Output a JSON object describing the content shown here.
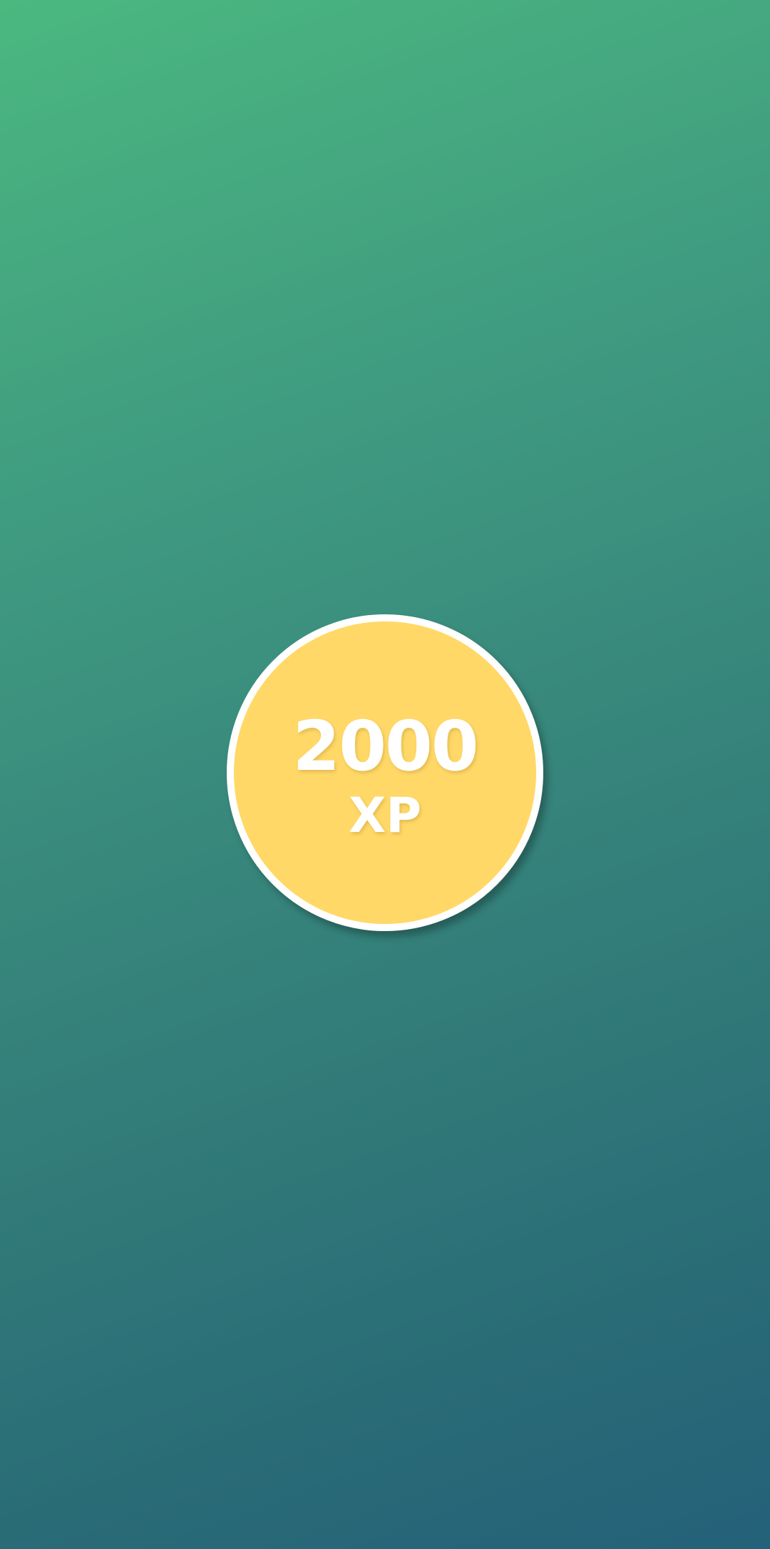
{
  "background": {
    "gradient_start": "#4bb880",
    "gradient_end": "#24617a"
  },
  "badge": {
    "amount": "2000",
    "unit": "XP",
    "fill_color": "#ffd867",
    "border_color": "#ffffff",
    "text_color": "#ffffff"
  }
}
